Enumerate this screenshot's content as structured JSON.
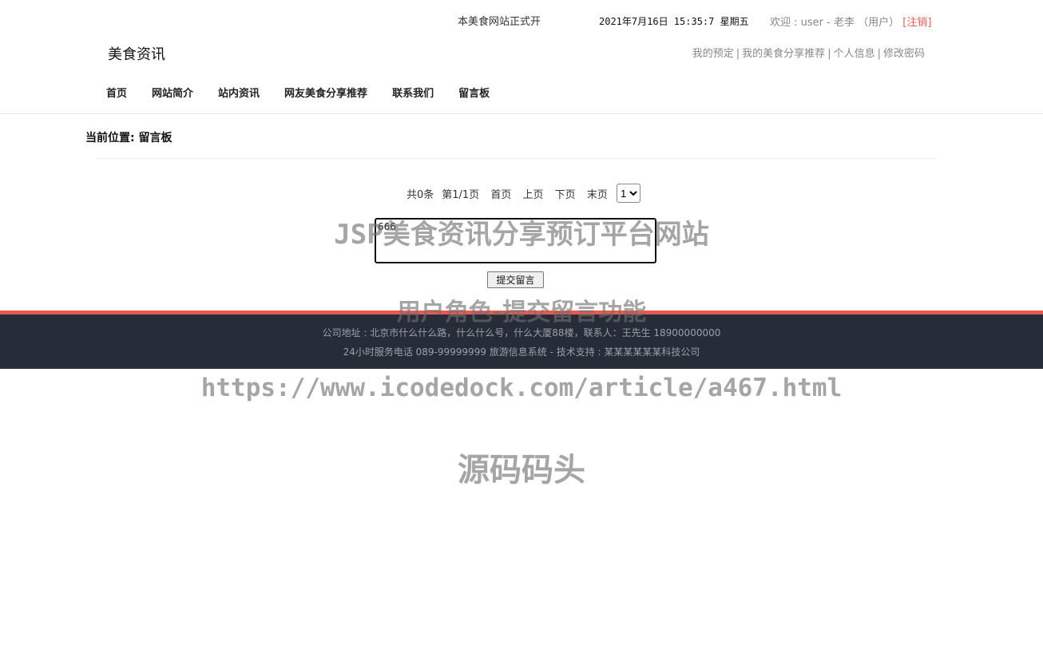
{
  "topbar": {
    "marquee": "本美食网站正式开",
    "datetime": "2021年7月16日 15:35:7 星期五",
    "welcome_prefix": "欢迎 : ",
    "username": "user",
    "dash": " - ",
    "realname": "老李",
    "role": " （用户） ",
    "logout": "[注销]"
  },
  "header": {
    "logo": "美食资讯",
    "user_links": [
      "我的预定",
      "我的美食分享推荐",
      "个人信息",
      "修改密码"
    ],
    "sep": "|"
  },
  "nav": {
    "items": [
      "首页",
      "网站简介",
      "站内资讯",
      "网友美食分享推荐",
      "联系我们",
      "留言板"
    ]
  },
  "breadcrumb": "当前位置: 留言板",
  "pager": {
    "total": "共0条",
    "page_info": "第1/1页",
    "first": "首页",
    "prev": "上页",
    "next": "下页",
    "last": "末页",
    "selected_page": "1"
  },
  "message_form": {
    "value": "666",
    "submit_label": "提交留言"
  },
  "footer": {
    "line1": "公司地址 : 北京市什么什么路，什么什么号，什么大厦88楼，联系人：王先生 18900000000",
    "line2": "24小时服务电话   089-99999999   旅游信息系统 - 技术支持 : 某某某某某某科技公司"
  },
  "watermarks": {
    "title": "JSP美食资讯分享预订平台网站",
    "subtitle": "用户角色-提交留言功能",
    "url": "https://www.icodedock.com/article/a467.html",
    "brand": "源码码头"
  },
  "colors": {
    "accent": "#e85a4f",
    "footer_bg": "#262d38"
  }
}
